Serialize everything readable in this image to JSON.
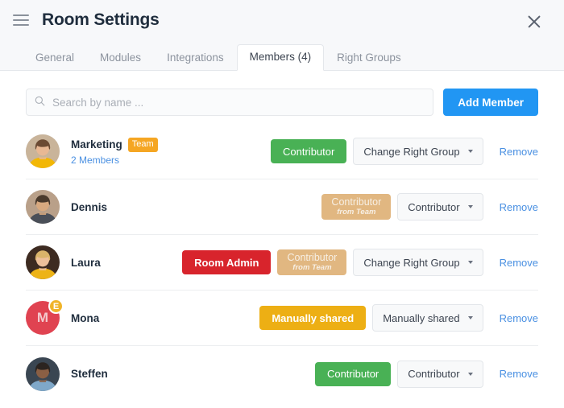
{
  "header": {
    "title": "Room Settings",
    "menu_icon": "hamburger-icon",
    "close_icon": "close-icon"
  },
  "tabs": [
    {
      "label": "General",
      "active": false
    },
    {
      "label": "Modules",
      "active": false
    },
    {
      "label": "Integrations",
      "active": false
    },
    {
      "label": "Members (4)",
      "active": true
    },
    {
      "label": "Right Groups",
      "active": false
    }
  ],
  "toolbar": {
    "search_placeholder": "Search by name ...",
    "search_value": "",
    "search_icon": "search-icon",
    "add_member_label": "Add Member"
  },
  "colors": {
    "accent_blue": "#2196f3",
    "link_blue": "#4a90e2",
    "green": "#49b155",
    "red": "#d8242c",
    "yellow": "#edaf14",
    "tan": "#e1b781",
    "team_badge_orange": "#f5a623",
    "avatar_red": "#e04351",
    "badge_amber": "#f0b429"
  },
  "members": [
    {
      "name": "Marketing",
      "badge": "Team",
      "sub": "2 Members",
      "avatar_type": "photo",
      "avatar_style": "woman-yellow-top",
      "sub_badge": "",
      "pills": [
        {
          "text": "Contributor",
          "sub": "",
          "color": "green"
        }
      ],
      "dropdown_label": "Change Right Group",
      "remove_label": "Remove"
    },
    {
      "name": "Dennis",
      "badge": "",
      "sub": "",
      "avatar_type": "photo",
      "avatar_style": "man-beard",
      "sub_badge": "",
      "pills": [
        {
          "text": "Contributor",
          "sub": "from Team",
          "color": "tan"
        }
      ],
      "dropdown_label": "Contributor",
      "remove_label": "Remove"
    },
    {
      "name": "Laura",
      "badge": "",
      "sub": "",
      "avatar_type": "photo",
      "avatar_style": "woman-blonde",
      "sub_badge": "",
      "pills": [
        {
          "text": "Room Admin",
          "sub": "",
          "color": "red"
        },
        {
          "text": "Contributor",
          "sub": "from Team",
          "color": "tan"
        }
      ],
      "dropdown_label": "Change Right Group",
      "remove_label": "Remove"
    },
    {
      "name": "Mona",
      "badge": "",
      "sub": "",
      "avatar_type": "initial",
      "avatar_initial": "M",
      "sub_badge": "E",
      "pills": [
        {
          "text": "Manually shared",
          "sub": "",
          "color": "yellow"
        }
      ],
      "dropdown_label": "Manually shared",
      "remove_label": "Remove"
    },
    {
      "name": "Steffen",
      "badge": "",
      "sub": "",
      "avatar_type": "photo",
      "avatar_style": "man-blue-shirt",
      "sub_badge": "",
      "pills": [
        {
          "text": "Contributor",
          "sub": "",
          "color": "green"
        }
      ],
      "dropdown_label": "Contributor",
      "remove_label": "Remove"
    }
  ]
}
